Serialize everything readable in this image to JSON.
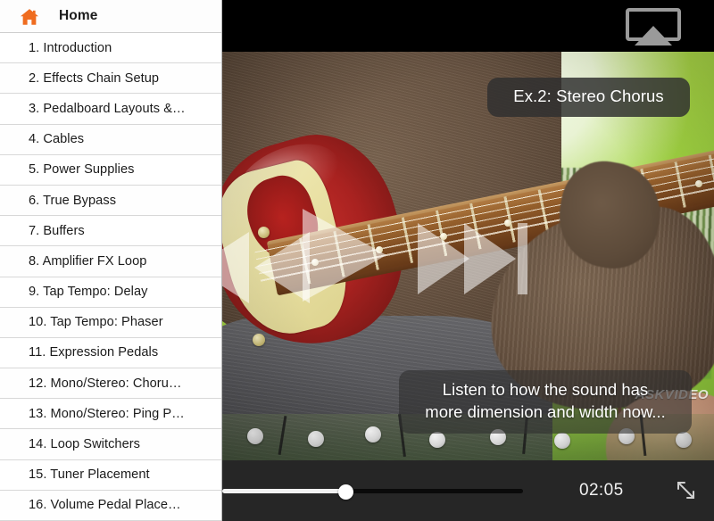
{
  "sidebar": {
    "header": {
      "icon": "home-icon",
      "title": "Home"
    },
    "items": [
      {
        "label": "1. Introduction"
      },
      {
        "label": "2. Effects Chain Setup"
      },
      {
        "label": "3. Pedalboard Layouts &…"
      },
      {
        "label": "4. Cables"
      },
      {
        "label": "5. Power Supplies"
      },
      {
        "label": "6. True Bypass"
      },
      {
        "label": "7. Buffers"
      },
      {
        "label": "8. Amplifier FX Loop"
      },
      {
        "label": "9. Tap Tempo: Delay"
      },
      {
        "label": "10. Tap Tempo: Phaser"
      },
      {
        "label": "11. Expression Pedals"
      },
      {
        "label": "12. Mono/Stereo: Choru…"
      },
      {
        "label": "13. Mono/Stereo: Ping P…"
      },
      {
        "label": "14. Loop Switchers"
      },
      {
        "label": "15. Tuner Placement"
      },
      {
        "label": "16. Volume Pedal Place…"
      }
    ]
  },
  "video": {
    "topbar": {
      "airplay_icon": "airplay-icon"
    },
    "title_overlay": "Ex.2: Stereo Chorus",
    "caption": {
      "line1": "Listen to how the sound has",
      "line2": "more dimension and width now..."
    },
    "watermark": "ASKVIDEO",
    "transport": {
      "previous_icon": "previous-track-icon",
      "play_icon": "play-icon",
      "next_icon": "next-track-icon"
    },
    "controls": {
      "current_time": "02:05",
      "progress_percent": 41,
      "fullscreen_icon": "fullscreen-icon"
    }
  },
  "colors": {
    "accent": "#ef6c1f",
    "sidebar_bg": "#ffffff",
    "control_bar_bg": "#262626",
    "seek_fill": "#f2f2f2",
    "seek_track": "#0a0a0a",
    "chip_bg": "rgba(48,48,48,0.84)"
  }
}
